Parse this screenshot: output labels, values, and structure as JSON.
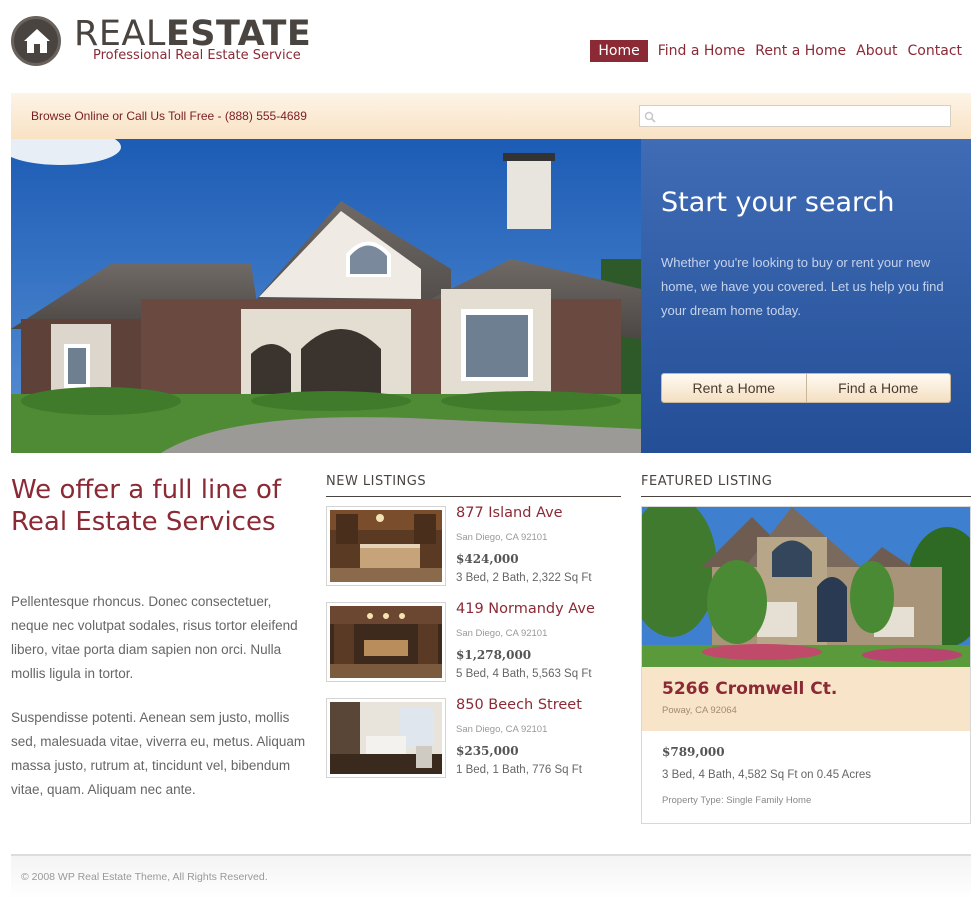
{
  "brand": {
    "title_light": "REAL",
    "title_bold": "ESTATE",
    "tagline": "Professional Real Estate Service",
    "icon": "house-icon",
    "primary_color": "#8b2a35"
  },
  "nav": {
    "items": [
      {
        "label": "Home",
        "active": true
      },
      {
        "label": "Find a Home",
        "active": false
      },
      {
        "label": "Rent a Home",
        "active": false
      },
      {
        "label": "About",
        "active": false
      },
      {
        "label": "Contact",
        "active": false
      }
    ]
  },
  "browse_bar": {
    "call_text": "Browse Online or Call Us Toll Free - (888) 555-4689",
    "search_icon": "search-icon",
    "search_placeholder": ""
  },
  "hero": {
    "heading": "Start your search",
    "text": "Whether you're looking to buy or rent your new home, we have you covered. Let us help you find your dream home today.",
    "buttons": [
      "Rent a Home",
      "Find a Home"
    ]
  },
  "intro": {
    "heading": "We offer a full line of Real Estate Services",
    "paragraphs": [
      "Pellentesque rhoncus. Donec consectetuer, neque nec volutpat sodales, risus tortor eleifend libero, vitae porta diam sapien non orci. Nulla mollis ligula in tortor.",
      "Suspendisse potenti. Aenean sem justo, mollis sed, malesuada vitae, viverra eu, metus. Aliquam massa justo, rutrum at, tincidunt vel, bibendum vitae, quam. Aliquam nec ante."
    ]
  },
  "new_listings": {
    "heading": "NEW LISTINGS",
    "items": [
      {
        "title": "877 Island Ave",
        "location": "San Diego, CA 92101",
        "price": "$424,000",
        "specs": "3 Bed, 2 Bath, 2,322 Sq Ft"
      },
      {
        "title": "419 Normandy Ave",
        "location": "San Diego, CA 92101",
        "price": "$1,278,000",
        "specs": "5 Bed, 4 Bath, 5,563 Sq Ft"
      },
      {
        "title": "850 Beech Street",
        "location": "San Diego, CA 92101",
        "price": "$235,000",
        "specs": "1 Bed, 1 Bath, 776 Sq Ft"
      }
    ]
  },
  "featured": {
    "heading": "FEATURED LISTING",
    "title": "5266 Cromwell Ct.",
    "location": "Poway, CA 92064",
    "price": "$789,000",
    "specs": "3 Bed, 4 Bath, 4,582 Sq Ft on 0.45 Acres",
    "property_type": "Property Type: Single Family Home"
  },
  "footer": {
    "copyright": "© 2008 WP Real Estate Theme, All Rights Reserved."
  }
}
